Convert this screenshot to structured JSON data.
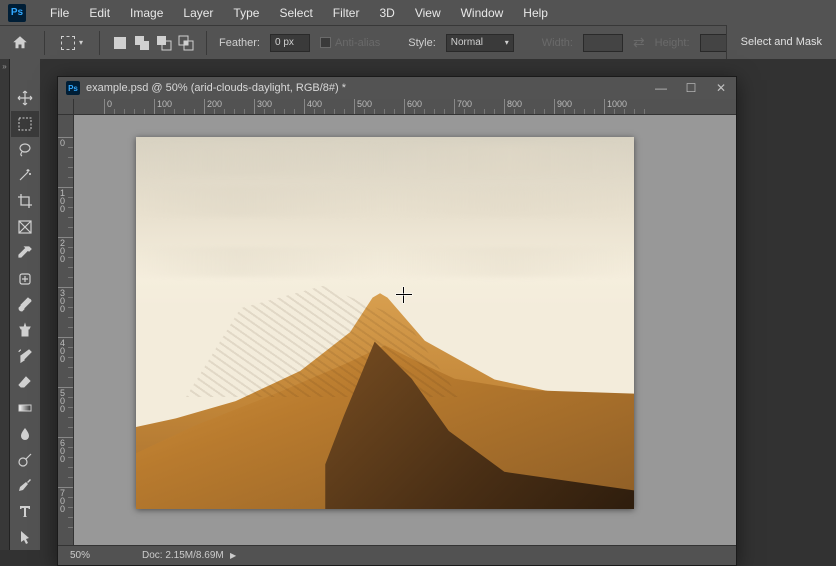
{
  "menubar": {
    "items": [
      "File",
      "Edit",
      "Image",
      "Layer",
      "Type",
      "Select",
      "Filter",
      "3D",
      "View",
      "Window",
      "Help"
    ]
  },
  "optbar": {
    "feather_label": "Feather:",
    "feather_value": "0 px",
    "antialias_label": "Anti-alias",
    "style_label": "Style:",
    "style_value": "Normal",
    "width_label": "Width:",
    "height_label": "Height:",
    "selectmask": "Select and Mask"
  },
  "document": {
    "title": "example.psd @ 50% (arid-clouds-daylight, RGB/8#) *",
    "ruler_h": [
      0,
      100,
      200,
      300,
      400,
      500,
      600,
      700,
      800,
      900,
      1000
    ],
    "ruler_v": [
      0,
      100,
      200,
      300,
      400,
      500,
      600,
      700
    ],
    "status_zoom": "50%",
    "status_doc": "Doc: 2.15M/8.69M"
  },
  "tools": [
    {
      "n": "move-tool"
    },
    {
      "n": "rect-marquee-tool",
      "sel": true
    },
    {
      "n": "lasso-tool"
    },
    {
      "n": "magic-wand-tool"
    },
    {
      "n": "crop-tool"
    },
    {
      "n": "frame-tool"
    },
    {
      "n": "eyedropper-tool"
    },
    {
      "n": "healing-brush-tool"
    },
    {
      "n": "brush-tool"
    },
    {
      "n": "clone-stamp-tool"
    },
    {
      "n": "history-brush-tool"
    },
    {
      "n": "eraser-tool"
    },
    {
      "n": "gradient-tool"
    },
    {
      "n": "blur-tool"
    },
    {
      "n": "dodge-tool"
    },
    {
      "n": "pen-tool"
    },
    {
      "n": "type-tool"
    },
    {
      "n": "path-select-tool"
    }
  ]
}
